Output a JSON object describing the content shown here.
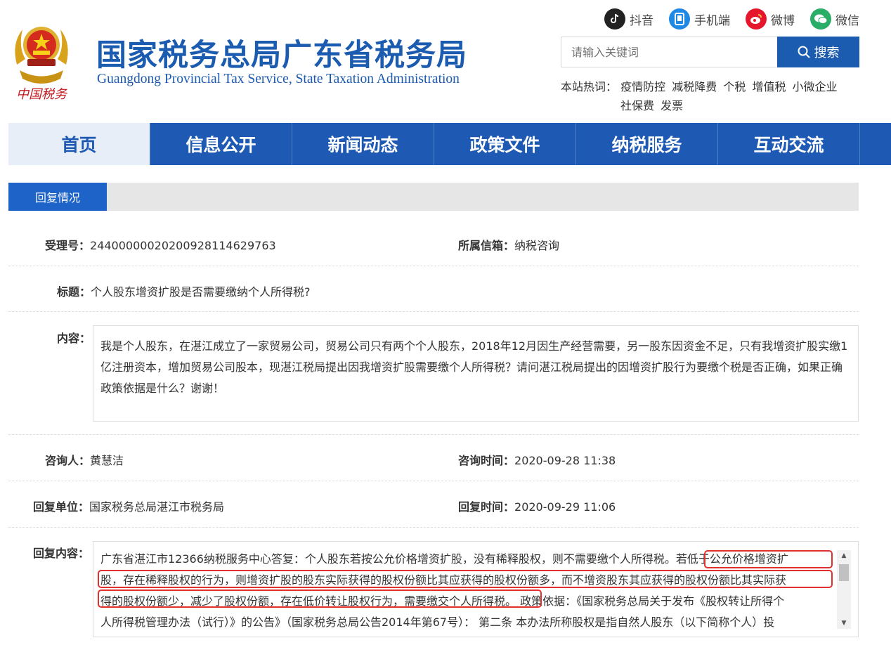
{
  "header": {
    "title": "国家税务总局广东省税务局",
    "subtitle": "Guangdong Provincial Tax Service, State Taxation Administration",
    "emblem_caption": "中国税务",
    "social": [
      {
        "label": "抖音",
        "icon": "douyin-icon",
        "color": "#1a1a1a"
      },
      {
        "label": "手机端",
        "icon": "mobile-icon",
        "color": "#1e88e5"
      },
      {
        "label": "微博",
        "icon": "weibo-icon",
        "color": "#e6162d"
      },
      {
        "label": "微信",
        "icon": "wechat-icon",
        "color": "#2aae67"
      }
    ],
    "search": {
      "placeholder": "请输入关键词",
      "button": "搜索"
    },
    "hot": {
      "label": "本站热词：",
      "line1": [
        "疫情防控",
        "减税降费",
        "个税",
        "增值税",
        "小微企业"
      ],
      "line2": [
        "社保费",
        "发票"
      ]
    }
  },
  "nav": [
    "首页",
    "信息公开",
    "新闻动态",
    "政策文件",
    "纳税服务",
    "互动交流"
  ],
  "section": {
    "tab": "回复情况"
  },
  "record": {
    "id_label": "受理号：",
    "id_value": "244000000202009281146297​63",
    "mailbox_label": "所属信箱：",
    "mailbox_value": "纳税咨询",
    "title_label": "标题：",
    "title_value": "个人股东增资扩股是否需要缴纳个人所得税?",
    "content_label": "内容：",
    "content_value": "我是个人股东，在湛江成立了一家贸易公司，贸易公司只有两个个人股东，2018年12月因生产经营需要，另一股东因资金不足，只有我增资扩股实缴1亿注册资本，增加贸易公司股本，现湛江税局提出因我增资扩股需要缴个人所得税？请问湛江税局提出的因增资扩股行为要缴个税是否正确，如果正确政策依据是什么？谢谢！",
    "asker_label": "咨询人：",
    "asker_value": "黄慧洁",
    "ask_time_label": "咨询时间：",
    "ask_time_value": "2020-09-28 11:38",
    "reply_unit_label": "回复单位：",
    "reply_unit_value": "国家税务总局湛江市税务局",
    "reply_time_label": "回复时间：",
    "reply_time_value": "2020-09-29 11:06",
    "reply_label": "回复内容：",
    "reply_lines": [
      "广东省湛江市12366纳税服务中心答复：个人股东若按公允价格增资扩股，没有稀释股权，则不需要缴个人所得税。若低于公允价格增资扩",
      "股，存在稀释股权的行为，则增资扩股的股东实际获得的股权份额比其应获得的股权份额多，而不增资股东其应获得的股权份额比其实际获",
      "得的股权份额少，减少了股权份额，存在低价转让股权行为，需要缴交个人所得税。 政策依据：《国家税务总局关于发布《股权转让所得个",
      "人所得税管理办法（试行）》的公告》（国家税务总局公告2014年第67号）： 第二条 本办法所称股权是指自然人股东（以下简称个人）投"
    ]
  }
}
